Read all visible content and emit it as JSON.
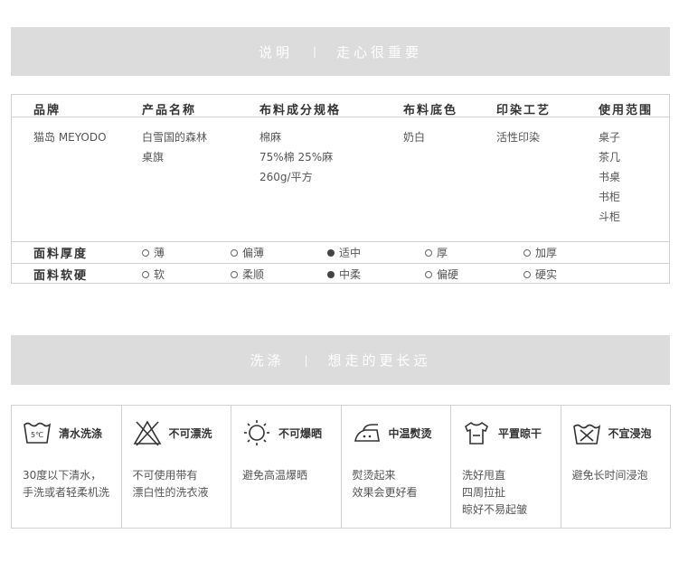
{
  "banner1": {
    "left": "说明",
    "sep": "|",
    "right": "走心很重要"
  },
  "spec": {
    "headers": [
      "品牌",
      "产品名称",
      "布料成分规格",
      "布料底色",
      "印染工艺",
      "使用范围"
    ],
    "brand": "猫岛 MEYODO",
    "product_name": [
      "白雪国的森林",
      "桌旗"
    ],
    "fabric_spec": [
      "棉麻",
      "75%棉 25%麻",
      "260g/平方"
    ],
    "base_color": "奶白",
    "print_process": "活性印染",
    "usage": [
      "桌子",
      "茶几",
      "书桌",
      "书柜",
      "斗柜"
    ]
  },
  "thickness": {
    "label": "面料厚度",
    "options": [
      "薄",
      "偏薄",
      "适中",
      "厚",
      "加厚"
    ],
    "selected": 2
  },
  "softness": {
    "label": "面料软硬",
    "options": [
      "软",
      "柔顺",
      "中柔",
      "偏硬",
      "硬实"
    ],
    "selected": 2
  },
  "banner2": {
    "left": "洗涤",
    "sep": "|",
    "right": "想走的更长远"
  },
  "care": [
    {
      "icon": "wash-30-icon",
      "icon_text": "5℃",
      "title": "清水洗涤",
      "desc": "30度以下清水，\n手洗或者轻柔机洗"
    },
    {
      "icon": "no-bleach-icon",
      "title": "不可漂洗",
      "desc": "不可使用带有\n漂白性的洗衣液"
    },
    {
      "icon": "no-sun-icon",
      "title": "不可爆晒",
      "desc": "避免高温爆晒"
    },
    {
      "icon": "iron-medium-icon",
      "title": "中温熨烫",
      "desc": "熨烫起来\n效果会更好看"
    },
    {
      "icon": "dry-flat-icon",
      "title": "平置晾干",
      "desc": "洗好甩直\n四周拉扯\n晾好不易起皱"
    },
    {
      "icon": "no-soak-icon",
      "title": "不宜浸泡",
      "desc": "避免长时间浸泡"
    }
  ]
}
